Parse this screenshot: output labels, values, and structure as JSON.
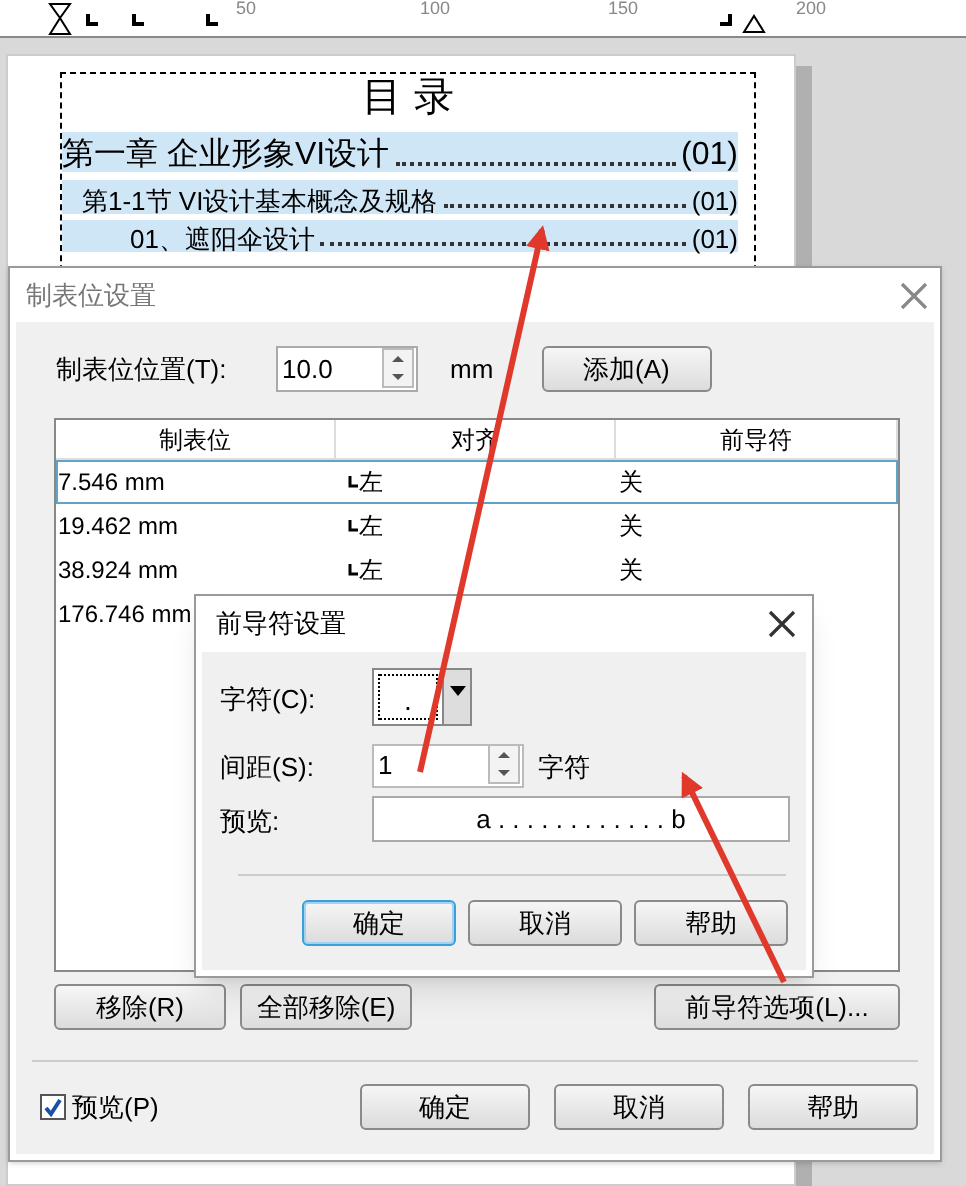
{
  "ruler": {
    "labels": [
      "50",
      "100",
      "150",
      "200"
    ]
  },
  "document": {
    "title": "目 录",
    "toc": [
      {
        "text": "第一章  企业形象VI设计",
        "page": "(01)",
        "children": [
          {
            "text": "第1-1节 VI设计基本概念及规格",
            "page": "(01)",
            "children": [
              {
                "text": "01、遮阳伞设计",
                "page": "(01)"
              }
            ]
          }
        ]
      }
    ]
  },
  "tab_dialog": {
    "title": "制表位设置",
    "position_label": "制表位位置(T):",
    "position_value": "10.0",
    "unit": "mm",
    "add_button": "添加(A)",
    "columns": [
      "制表位",
      "对齐",
      "前导符"
    ],
    "rows": [
      {
        "tab": "7.546 mm",
        "align": "左",
        "leader": "关",
        "selected": true
      },
      {
        "tab": "19.462 mm",
        "align": "左",
        "leader": "关",
        "selected": false
      },
      {
        "tab": "38.924 mm",
        "align": "左",
        "leader": "关",
        "selected": false
      },
      {
        "tab": "176.746 mm",
        "selected": false
      }
    ],
    "list_buttons": [
      "移除(R)",
      "全部移除(E)",
      "前导符选项(L)..."
    ],
    "preview": {
      "label": "预览(P)",
      "checked": true
    },
    "buttons": [
      "确定",
      "取消",
      "帮助"
    ]
  },
  "leader_dialog": {
    "title": "前导符设置",
    "char_label": "字符(C):",
    "char_value": ".",
    "spacing_label": "间距(S):",
    "spacing_value": "1",
    "spacing_unit": "字符",
    "preview_label": "预览:",
    "preview_text": "a . . . . . . . . . . . . b",
    "buttons": [
      {
        "label": "确定",
        "default": true
      },
      {
        "label": "取消",
        "default": false
      },
      {
        "label": "帮助",
        "default": false
      }
    ]
  }
}
